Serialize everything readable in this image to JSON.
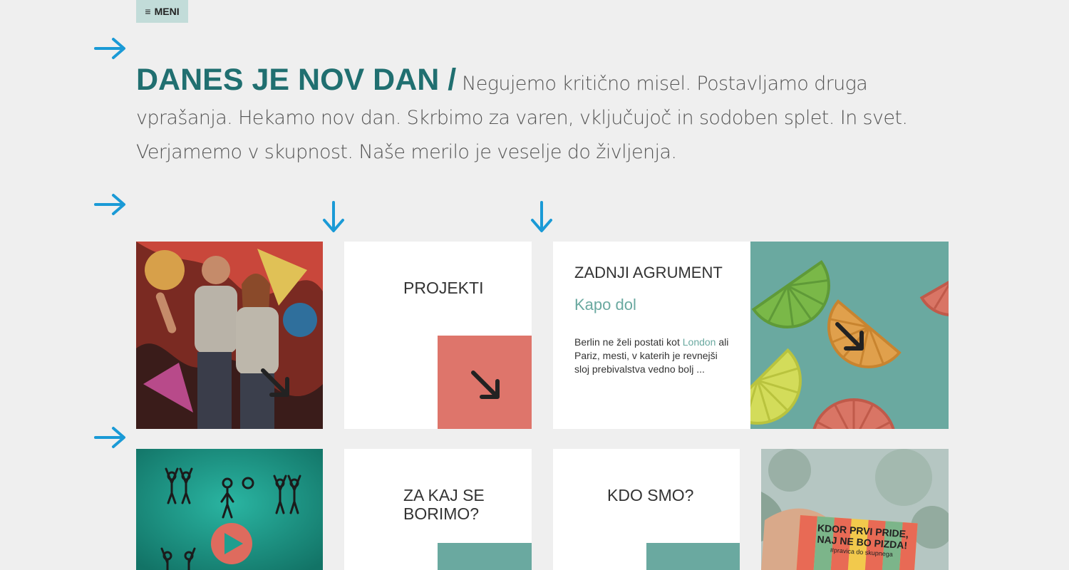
{
  "menu": {
    "label": "MENI",
    "icon": "hamburger-icon"
  },
  "intro": {
    "headline": "DANES JE NOV DAN /",
    "text": " Negujemo kritično misel. Postavljamo druga vprašanja. Hekamo nov dan. Skrbimo za varen, vključujoč in sodoben splet. In svet. Verjamemo v skupnost. Naše merilo je veselje do življenja."
  },
  "tiles": {
    "projekti": {
      "title": "PROJEKTI"
    },
    "article": {
      "title": "ZADNJI AGRUMENT",
      "subtitle": "Kapo dol",
      "body_before": "Berlin ne želi postati kot ",
      "link": "London",
      "body_after": " ali Pariz, mesti, v katerih je revnejši sloj prebivalstva vedno bolj ..."
    },
    "borimo": {
      "title": "ZA KAJ SE BORIMO?"
    },
    "kdo": {
      "title": "KDO SMO?"
    },
    "card": {
      "line1": "KDOR PRVI PRIDE,",
      "line2": "NAJ NE BO PIZDA!",
      "tag": "#pravica do skupnega"
    }
  },
  "colors": {
    "accent_arrow": "#1a9ad6",
    "headline": "#206f70",
    "salmon": "#de756b",
    "teal": "#6aa9a0",
    "menu_bg": "#c2dcd9",
    "page_bg": "#efefef"
  }
}
